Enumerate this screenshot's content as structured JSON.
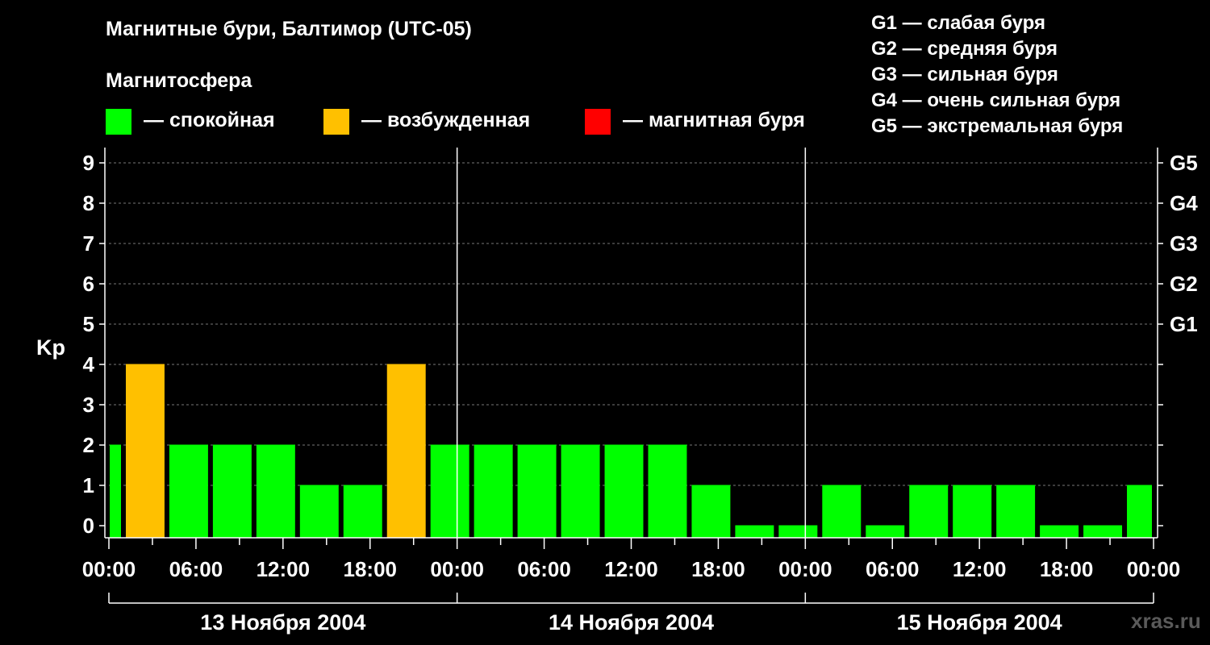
{
  "title": "Магнитные бури, Балтимор (UTC-05)",
  "legend": {
    "heading": "Магнитосфера",
    "items": [
      {
        "label": "— спокойная",
        "color": "#00FF00"
      },
      {
        "label": "— возбужденная",
        "color": "#FFC000"
      },
      {
        "label": "— магнитная буря",
        "color": "#FF0000"
      }
    ]
  },
  "storm_scale": [
    "G1 — слабая буря",
    "G2 — средняя буря",
    "G3 — сильная буря",
    "G4 — очень сильная буря",
    "G5 — экстремальная буря"
  ],
  "watermark": "xras.ru",
  "chart_data": {
    "type": "bar",
    "ylabel": "Kp",
    "ylim": [
      0,
      9
    ],
    "yticks": [
      0,
      1,
      2,
      3,
      4,
      5,
      6,
      7,
      8,
      9
    ],
    "right_axis_labels": [
      {
        "kp": 5,
        "label": "G1"
      },
      {
        "kp": 6,
        "label": "G2"
      },
      {
        "kp": 7,
        "label": "G3"
      },
      {
        "kp": 8,
        "label": "G4"
      },
      {
        "kp": 9,
        "label": "G5"
      }
    ],
    "grid": "horizontal dashed",
    "xlim_hours": [
      0,
      72
    ],
    "x_tick_labels": [
      "00:00",
      "06:00",
      "12:00",
      "18:00",
      "00:00",
      "06:00",
      "12:00",
      "18:00",
      "00:00",
      "06:00",
      "12:00",
      "18:00",
      "00:00"
    ],
    "days": [
      "13 Ноября 2004",
      "14 Ноября 2004",
      "15 Ноября 2004"
    ],
    "colors": {
      "quiet": "#00FF00",
      "active": "#FFC000",
      "storm": "#FF0000"
    },
    "bars": [
      {
        "start": 0,
        "end": 1,
        "kp": 2,
        "state": "quiet"
      },
      {
        "start": 1,
        "end": 4,
        "kp": 4,
        "state": "active"
      },
      {
        "start": 4,
        "end": 7,
        "kp": 2,
        "state": "quiet"
      },
      {
        "start": 7,
        "end": 10,
        "kp": 2,
        "state": "quiet"
      },
      {
        "start": 10,
        "end": 13,
        "kp": 2,
        "state": "quiet"
      },
      {
        "start": 13,
        "end": 16,
        "kp": 1,
        "state": "quiet"
      },
      {
        "start": 16,
        "end": 19,
        "kp": 1,
        "state": "quiet"
      },
      {
        "start": 19,
        "end": 22,
        "kp": 4,
        "state": "active"
      },
      {
        "start": 22,
        "end": 25,
        "kp": 2,
        "state": "quiet"
      },
      {
        "start": 25,
        "end": 28,
        "kp": 2,
        "state": "quiet"
      },
      {
        "start": 28,
        "end": 31,
        "kp": 2,
        "state": "quiet"
      },
      {
        "start": 31,
        "end": 34,
        "kp": 2,
        "state": "quiet"
      },
      {
        "start": 34,
        "end": 37,
        "kp": 2,
        "state": "quiet"
      },
      {
        "start": 37,
        "end": 40,
        "kp": 2,
        "state": "quiet"
      },
      {
        "start": 40,
        "end": 43,
        "kp": 1,
        "state": "quiet"
      },
      {
        "start": 43,
        "end": 46,
        "kp": 0,
        "state": "quiet"
      },
      {
        "start": 46,
        "end": 49,
        "kp": 0,
        "state": "quiet"
      },
      {
        "start": 49,
        "end": 52,
        "kp": 1,
        "state": "quiet"
      },
      {
        "start": 52,
        "end": 55,
        "kp": 0,
        "state": "quiet"
      },
      {
        "start": 55,
        "end": 58,
        "kp": 1,
        "state": "quiet"
      },
      {
        "start": 58,
        "end": 61,
        "kp": 1,
        "state": "quiet"
      },
      {
        "start": 61,
        "end": 64,
        "kp": 1,
        "state": "quiet"
      },
      {
        "start": 64,
        "end": 67,
        "kp": 0,
        "state": "quiet"
      },
      {
        "start": 67,
        "end": 70,
        "kp": 0,
        "state": "quiet"
      },
      {
        "start": 70,
        "end": 72,
        "kp": 1,
        "state": "quiet"
      }
    ]
  }
}
